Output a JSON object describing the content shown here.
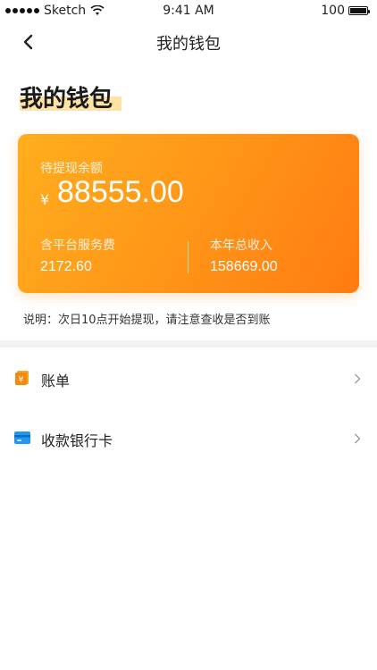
{
  "status_bar": {
    "carrier": "Sketch",
    "time": "9:41 AM",
    "battery": "100"
  },
  "nav": {
    "title": "我的钱包"
  },
  "page_title": "我的钱包",
  "card": {
    "label": "待提现余额",
    "currency": "¥",
    "amount": "88555.00",
    "left_stat": {
      "label": "含平台服务费",
      "value": "2172.60"
    },
    "right_stat": {
      "label": "本年总收入",
      "value": "158669.00"
    }
  },
  "note": "说明：次日10点开始提现，请注意查收是否到账",
  "list": [
    {
      "label": "账单",
      "icon": "bill-icon"
    },
    {
      "label": "收款银行卡",
      "icon": "bank-card-icon"
    }
  ],
  "colors": {
    "card_start": "#ffae1e",
    "card_end": "#ff7b12",
    "accent_orange": "#f5a623",
    "bank_blue": "#2196f3"
  }
}
